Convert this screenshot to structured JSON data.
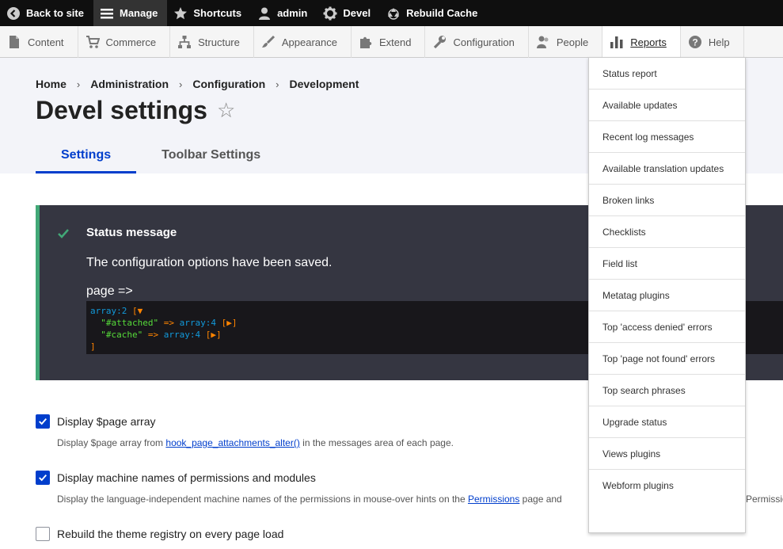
{
  "toolbar": {
    "items": [
      {
        "label": "Back to site",
        "icon": "back-icon"
      },
      {
        "label": "Manage",
        "icon": "menu-icon"
      },
      {
        "label": "Shortcuts",
        "icon": "star-icon"
      },
      {
        "label": "admin",
        "icon": "user-icon"
      },
      {
        "label": "Devel",
        "icon": "gear-icon"
      },
      {
        "label": "Rebuild Cache",
        "icon": "recycle-icon"
      }
    ]
  },
  "tray": {
    "items": [
      {
        "label": "Content",
        "icon": "file-icon"
      },
      {
        "label": "Commerce",
        "icon": "cart-icon"
      },
      {
        "label": "Structure",
        "icon": "sitemap-icon"
      },
      {
        "label": "Appearance",
        "icon": "brush-icon"
      },
      {
        "label": "Extend",
        "icon": "puzzle-icon"
      },
      {
        "label": "Configuration",
        "icon": "wrench-icon"
      },
      {
        "label": "People",
        "icon": "people-icon"
      },
      {
        "label": "Reports",
        "icon": "bar-chart-icon"
      },
      {
        "label": "Help",
        "icon": "help-icon"
      }
    ]
  },
  "breadcrumb": [
    "Home",
    "Administration",
    "Configuration",
    "Development"
  ],
  "page_title": "Devel settings",
  "tabs": [
    "Settings",
    "Toolbar Settings"
  ],
  "status": {
    "title": "Status message",
    "text": "The configuration options have been saved.",
    "page_label": "page =>",
    "dump": {
      "head": "array:2",
      "open": "[▼",
      "rows": [
        {
          "key": "\"#attached\"",
          "arrow": "=>",
          "val": "array:4",
          "toggle": "[▶]"
        },
        {
          "key": "\"#cache\"",
          "arrow": "=>",
          "val": "array:4",
          "toggle": "[▶]"
        }
      ],
      "close": "]"
    }
  },
  "form": {
    "opt1": {
      "label": "Display $page array",
      "checked": true,
      "desc_pre": "Display $page array from ",
      "desc_link": "hook_page_attachments_alter()",
      "desc_post": " in the messages area of each page."
    },
    "opt2": {
      "label": "Display machine names of permissions and modules",
      "checked": true,
      "desc_pre": "Display the language-independent machine names of the permissions in mouse-over hints on the ",
      "desc_link": "Permissions",
      "desc_post": " page and",
      "desc_tail": "Permissio"
    },
    "opt3": {
      "label": "Rebuild the theme registry on every page load",
      "checked": false
    }
  },
  "reports_menu": [
    "Status report",
    "Available updates",
    "Recent log messages",
    "Available translation updates",
    "Broken links",
    "Checklists",
    "Field list",
    "Metatag plugins",
    "Top 'access denied' errors",
    "Top 'page not found' errors",
    "Top search phrases",
    "Upgrade status",
    "Views plugins",
    "Webform plugins"
  ],
  "colors": {
    "accent": "#003ecc",
    "status_bg": "#353641",
    "status_border": "#42a877"
  }
}
